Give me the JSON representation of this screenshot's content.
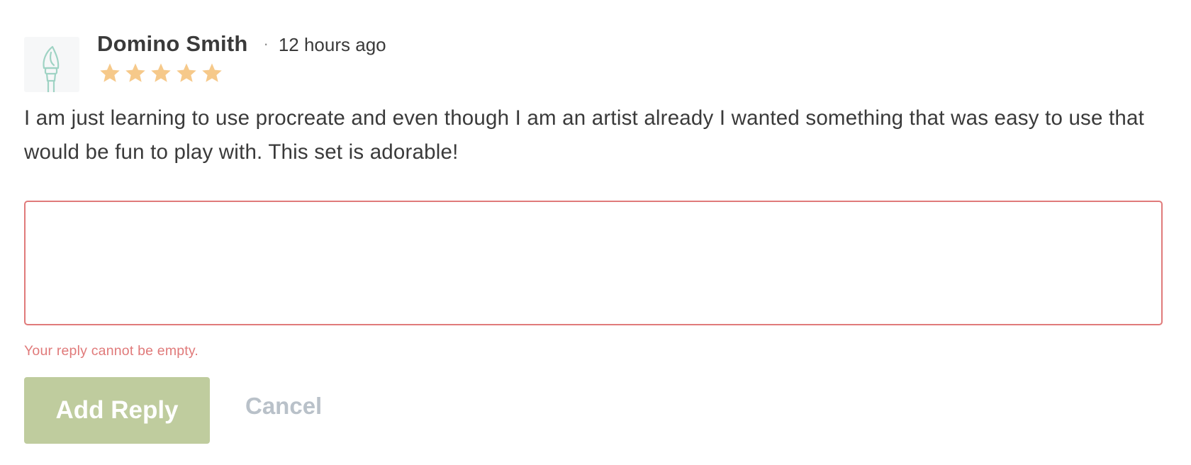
{
  "review": {
    "author": "Domino Smith",
    "separator": "·",
    "time": "12 hours ago",
    "rating": 5,
    "rating_max": 5,
    "body": "I am just learning to use procreate and even though I am an artist already I wanted something that was easy to use that would be fun to play with. This set is adorable!",
    "avatar_icon": "paintbrush-icon"
  },
  "reply_form": {
    "value": "",
    "placeholder": "",
    "error": "Your reply cannot be empty.",
    "submit_label": "Add Reply",
    "cancel_label": "Cancel"
  },
  "colors": {
    "star": "#f6c98a",
    "error": "#e07a7a",
    "button": "#bfcc9e",
    "cancel": "#b9c1c9",
    "avatar_icon": "#9fd3c4"
  }
}
